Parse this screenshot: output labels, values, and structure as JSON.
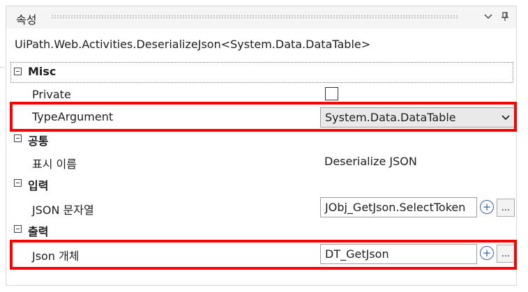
{
  "panel": {
    "title": "속성",
    "type_name": "UiPath.Web.Activities.DeserializeJson<System.Data.DataTable>"
  },
  "icons": {
    "dropdown": "chevron-down-icon",
    "pin": "pin-icon",
    "collapse": "minus-box-icon",
    "add": "plus-circle-icon"
  },
  "categories": {
    "misc": {
      "label": "Misc",
      "private": {
        "name": "Private",
        "checked": false
      },
      "type_argument": {
        "name": "TypeArgument",
        "value": "System.Data.DataTable"
      }
    },
    "common": {
      "label": "공통",
      "display_name": {
        "name": "표시 이름",
        "value": "Deserialize JSON"
      }
    },
    "input": {
      "label": "입력",
      "json_string": {
        "name": "JSON 문자열",
        "value": "JObj_GetJson.SelectToken"
      }
    },
    "output": {
      "label": "출력",
      "json_object": {
        "name": "Json 개체",
        "value": "DT_GetJson"
      }
    }
  },
  "buttons": {
    "ellipsis": "..."
  },
  "colors": {
    "highlight": "#ff0000",
    "add_button": "#3a5fb0"
  }
}
